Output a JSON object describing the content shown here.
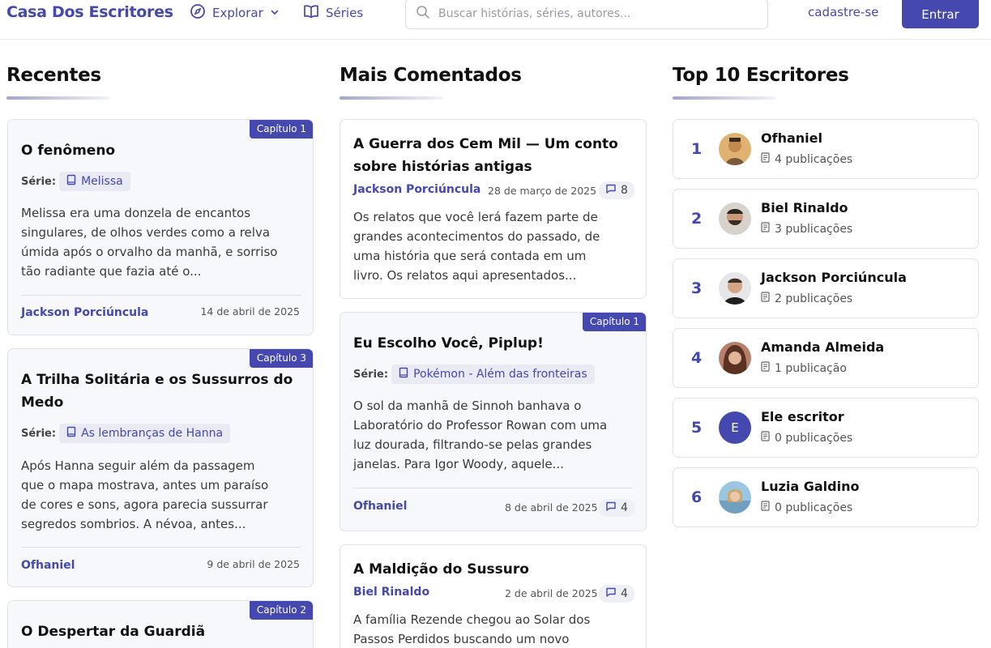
{
  "header": {
    "brand": "Casa Dos Escritores",
    "explore_label": "Explorar",
    "series_label": "Séries",
    "search_placeholder": "Buscar histórias, séries, autores...",
    "signup_label": "cadastre-se",
    "login_label": "Entrar"
  },
  "sections": {
    "recent_title": "Recentes",
    "most_commented_title": "Mais Comentados",
    "top_writers_title": "Top 10 Escritores"
  },
  "series_label": "Série:",
  "recent": [
    {
      "badge": "Capítulo 1",
      "title": "O fenômeno",
      "series": "Melissa",
      "excerpt": [
        "Melissa era uma donzela de encantos",
        "singulares, de olhos verdes como a relva",
        "úmida após o orvalho da manhã, e sorriso",
        "tão radiante que fazia até o..."
      ],
      "author": "Jackson Porciúncula",
      "date": "14 de abril de 2025"
    },
    {
      "badge": "Capítulo 3",
      "title": [
        "A Trilha Solitária e os Sussurros do",
        "Medo"
      ],
      "series": "As lembranças de Hanna",
      "excerpt": [
        "Após Hanna seguir além da passagem",
        "que o mapa mostrava, antes um paraíso",
        "de cores e sons, agora parecia sussurrar",
        "segredos sombrios. A névoa, antes..."
      ],
      "author": "Ofhaniel",
      "date": "9 de abril de 2025"
    },
    {
      "badge": "Capítulo 2",
      "title": "O Despertar da Guardiã"
    }
  ],
  "most_commented": [
    {
      "title": [
        "A Guerra dos Cem Mil — Um conto",
        "sobre histórias antigas"
      ],
      "author": "Jackson Porciúncula",
      "date": "28 de março de 2025",
      "comments": "8",
      "excerpt": [
        "Os relatos que você lerá fazem parte de",
        "grandes acontecimentos do passado, de",
        "uma história que será contada em um",
        "livro. Os relatos aqui apresentados..."
      ]
    },
    {
      "badge": "Capítulo 1",
      "title": "Eu Escolho Você, Piplup!",
      "series": "Pokémon - Além das fronteiras",
      "excerpt": [
        "O sol da manhã de Sinnoh banhava o",
        "Laboratório do Professor Rowan com uma",
        "luz dourada, filtrando-se pelas grandes",
        "janelas. Para Igor Woody, aquele..."
      ],
      "author": "Ofhaniel",
      "date": "8 de abril de 2025",
      "comments": "4"
    },
    {
      "title": "A Maldição do Sussuro",
      "author": "Biel Rinaldo",
      "date": "2 de abril de 2025",
      "comments": "4",
      "excerpt": [
        "A família Rezende chegou ao Solar dos",
        "Passos Perdidos buscando um novo"
      ]
    }
  ],
  "top_writers": [
    {
      "rank": "1",
      "name": "Ofhaniel",
      "pubs": "4 publicações"
    },
    {
      "rank": "2",
      "name": "Biel Rinaldo",
      "pubs": "3 publicações"
    },
    {
      "rank": "3",
      "name": "Jackson Porciúncula",
      "pubs": "2 publicações"
    },
    {
      "rank": "4",
      "name": "Amanda Almeida",
      "pubs": "1 publicação"
    },
    {
      "rank": "5",
      "name": "Ele escritor",
      "pubs": "0 publicações",
      "initial": "E"
    },
    {
      "rank": "6",
      "name": "Luzia Galdino",
      "pubs": "0 publicações"
    }
  ],
  "colors": {
    "accent": "#4548ae",
    "card_bg": "#f7f8fb",
    "chip_bg": "#e9eaf3"
  }
}
